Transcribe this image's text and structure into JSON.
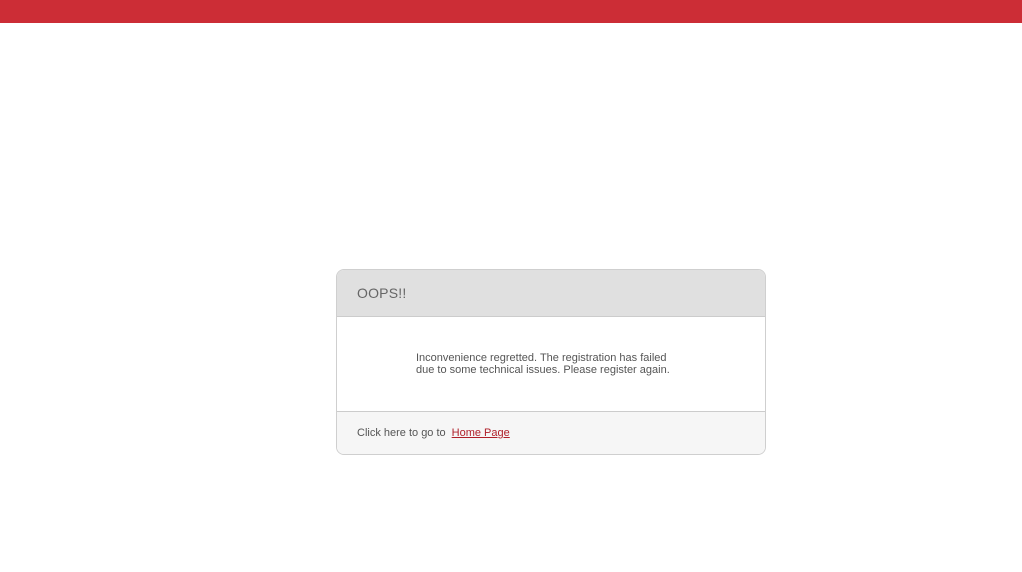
{
  "colors": {
    "top_bar": "#cc2d36",
    "link": "#b0202a"
  },
  "dialog": {
    "title": "OOPS!!",
    "message": "Inconvenience regretted. The registration has failed due to some technical issues. Please register again.",
    "footer_text": "Click here to go to",
    "home_link_label": "Home Page"
  }
}
